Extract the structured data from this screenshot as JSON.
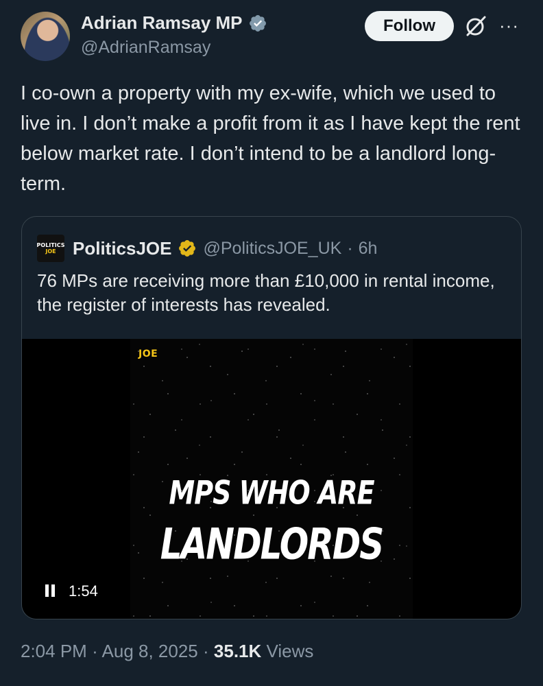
{
  "author": {
    "name": "Adrian Ramsay MP",
    "handle": "@AdrianRamsay"
  },
  "actions": {
    "follow_label": "Follow",
    "grok_icon": "grok-icon",
    "more_label": "···"
  },
  "tweet": {
    "text": "I co-own a property with my ex-wife, which we used to live in. I don’t make a profit from it as I have kept the rent below market rate. I don’t intend to be a landlord long-term."
  },
  "quote": {
    "avatar_line1": "POLITICS",
    "avatar_line2": "JOE",
    "name": "PoliticsJOE",
    "handle": "@PoliticsJOE_UK",
    "separator": "·",
    "time": "6h",
    "text": "76 MPs are receiving more than £10,000 in rental income, the register of interests has revealed.",
    "video": {
      "logo": "JOE",
      "title_line1": "MPS WHO ARE",
      "title_line2": "LANDLORDS",
      "duration": "1:54"
    }
  },
  "meta": {
    "time": "2:04 PM",
    "sep1": "·",
    "date": "Aug 8, 2025",
    "sep2": "·",
    "views_count": "35.1K",
    "views_label": "Views"
  },
  "colors": {
    "background": "#15202b",
    "verified": "#1d9bf0",
    "gold_verified": "#e2b719",
    "secondary_text": "#8b98a5"
  }
}
